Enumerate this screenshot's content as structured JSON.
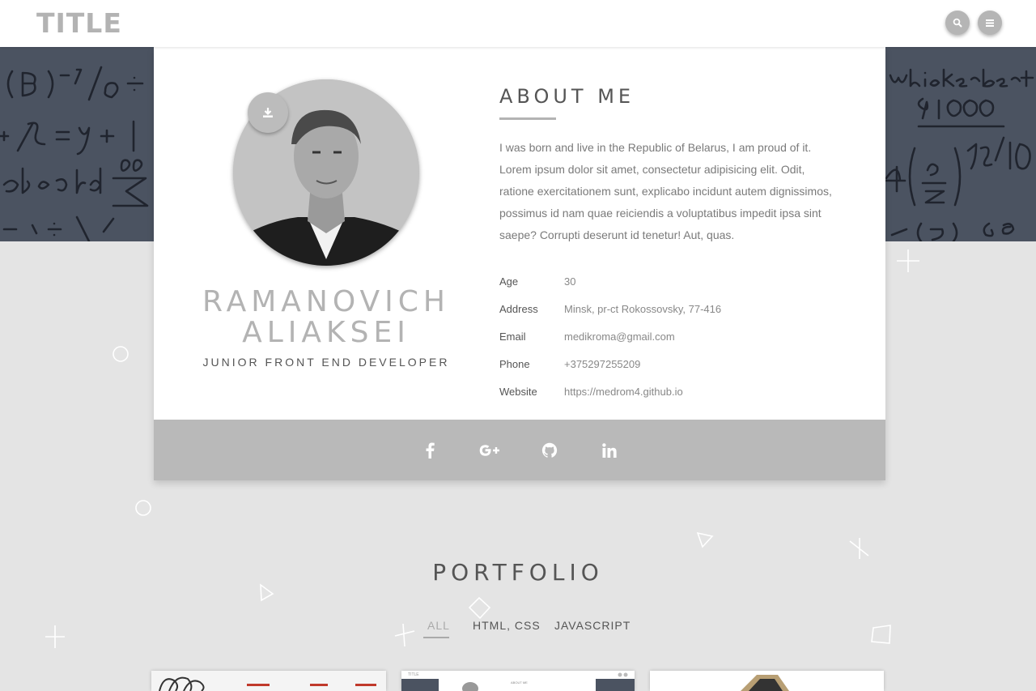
{
  "header": {
    "logo": "TITLE",
    "search_icon": "search-icon",
    "menu_icon": "menu-icon"
  },
  "profile": {
    "name_line1": "RAMANOVICH",
    "name_line2": "ALIAKSEI",
    "role": "JUNIOR FRONT END DEVELOPER",
    "download_icon": "download-icon"
  },
  "about": {
    "title": "ABOUT ME",
    "text": "I was born and live in the Republic of Belarus, I am proud of it. Lorem ipsum dolor sit amet, consectetur adipisicing elit. Odit, ratione exercitationem sunt, explicabo incidunt autem dignissimos, possimus id nam quae reiciendis a voluptatibus impedit ipsa sint saepe? Corrupti deserunt id tenetur! Aut, quas.",
    "info": [
      {
        "label": "Age",
        "value": "30"
      },
      {
        "label": "Address",
        "value": "Minsk, pr-ct Rokossovsky, 77-416"
      },
      {
        "label": "Email",
        "value": "medikroma@gmail.com"
      },
      {
        "label": "Phone",
        "value": "+375297255209"
      },
      {
        "label": "Website",
        "value": "https://medrom4.github.io"
      }
    ]
  },
  "social": [
    {
      "name": "facebook-icon"
    },
    {
      "name": "google-plus-icon"
    },
    {
      "name": "github-icon"
    },
    {
      "name": "linkedin-icon"
    }
  ],
  "portfolio": {
    "title": "PORTFOLIO",
    "filters": [
      "ALL",
      "HTML, CSS",
      "JAVASCRIPT"
    ],
    "active_filter": "ALL",
    "thumb2_title": "TITLE",
    "thumb2_heading": "ABOUT ME"
  },
  "colors": {
    "background": "#e4e4e4",
    "hero": "#4b5361",
    "accent_grey": "#b9b9b9",
    "text_dark": "#555555"
  }
}
